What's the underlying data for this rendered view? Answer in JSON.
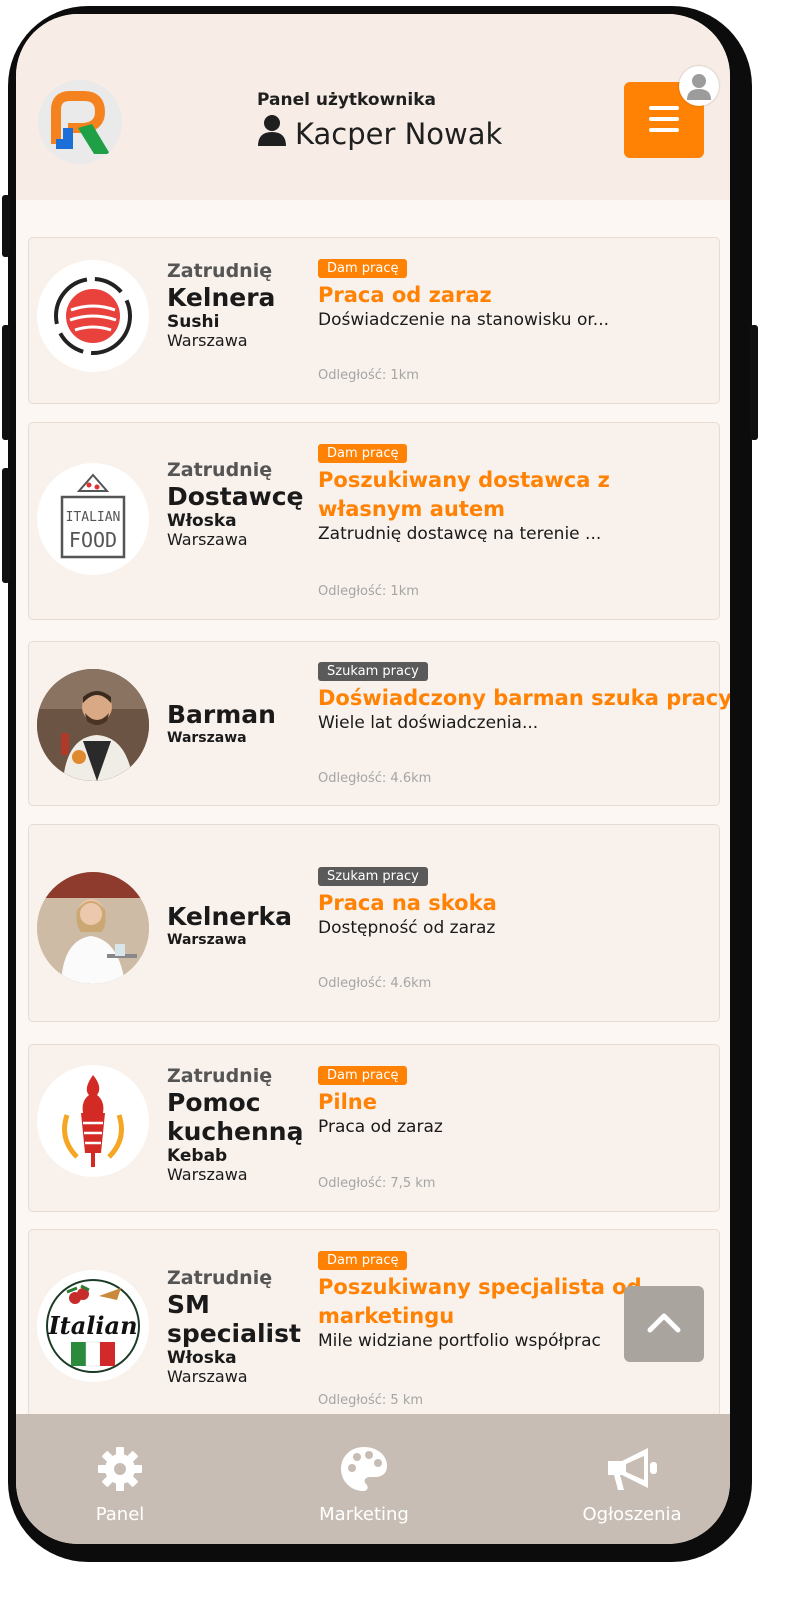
{
  "header": {
    "panel_label": "Panel użytkownika",
    "user_name": "Kacper Nowak"
  },
  "listings": [
    {
      "kind": "Zatrudnię",
      "position": "Kelnera",
      "cuisine": "Sushi",
      "city": "Warszawa",
      "badge": "Dam pracę",
      "badge_type": "hire",
      "title": "Praca od zaraz",
      "description": "Doświadczenie na stanowisku or...",
      "distance": "Odległość: 1km",
      "image_icon": "sushi-logo"
    },
    {
      "kind": "Zatrudnię",
      "position": "Dostawcę",
      "cuisine": "Włoska",
      "city": "Warszawa",
      "badge": "Dam pracę",
      "badge_type": "hire",
      "title": "Poszukiwany dostawca z własnym autem",
      "description": "Zatrudnię dostawcę na terenie ...",
      "distance": "Odległość: 1km",
      "image_icon": "italian-food-logo",
      "image_text_1": "ITALIAN",
      "image_text_2": "FOOD"
    },
    {
      "kind": "",
      "position": "Barman",
      "cuisine": "",
      "city": "Warszawa",
      "badge": "Szukam pracy",
      "badge_type": "seek",
      "title": "Doświadczony barman szuka pracy",
      "description": "Wiele lat doświadczenia...",
      "distance": "Odległość: 4.6km",
      "image_icon": "barman-photo"
    },
    {
      "kind": "",
      "position": "Kelnerka",
      "cuisine": "",
      "city": "Warszawa",
      "badge": "Szukam pracy",
      "badge_type": "seek",
      "title": "Praca na skoka",
      "description": "Dostępność od zaraz",
      "distance": "Odległość: 4.6km",
      "image_icon": "waitress-photo"
    },
    {
      "kind": "Zatrudnię",
      "position": "Pomoc kuchenną",
      "cuisine": "Kebab",
      "city": "Warszawa",
      "badge": "Dam pracę",
      "badge_type": "hire",
      "title": "Pilne",
      "description": "Praca od zaraz",
      "distance": "Odległość: 7,5 km",
      "image_icon": "kebab-logo"
    },
    {
      "kind": "Zatrudnię",
      "position": "SM specialist",
      "cuisine": "Włoska",
      "city": "Warszawa",
      "badge": "Dam pracę",
      "badge_type": "hire",
      "title": "Poszukiwany specjalista od marketingu",
      "description": "Mile widziane portfolio współprac",
      "distance": "Odległość: 5 km",
      "image_icon": "italian-logo",
      "image_text_1": "Italian"
    }
  ],
  "bottom_nav": [
    {
      "label": "Panel",
      "icon": "gear-icon"
    },
    {
      "label": "Marketing",
      "icon": "palette-icon"
    },
    {
      "label": "Ogłoszenia",
      "icon": "megaphone-icon"
    }
  ],
  "colors": {
    "accent": "#ff8204",
    "badge_seek": "#5a5a5a",
    "header_bg": "#f7ede6",
    "nav_bg": "#c8bdb4"
  }
}
